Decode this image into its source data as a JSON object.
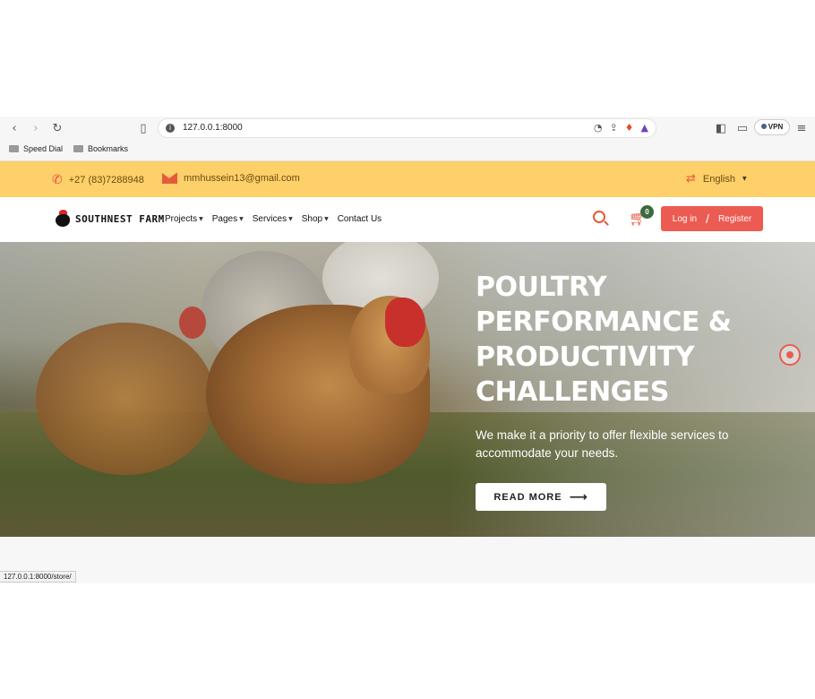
{
  "browser": {
    "url": "127.0.0.1:8000",
    "vpn_label": "VPN",
    "bookmarks": [
      "Speed Dial",
      "Bookmarks"
    ],
    "status_url": "127.0.0.1:8000/store/"
  },
  "topbar": {
    "phone": "+27 (83)7288948",
    "email": "mmhussein13@gmail.com",
    "language": "English"
  },
  "nav": {
    "logo_text": "SOUTHNEST FARM",
    "menu": [
      "Projects",
      "Pages",
      "Services",
      "Shop",
      "Contact Us"
    ],
    "cart_count": "0",
    "login": "Log in",
    "slash": "/",
    "register": "Register"
  },
  "hero": {
    "title": "POULTRY PERFORMANCE & PRODUCTIVITY CHALLENGES",
    "subtitle": "We make it a priority to offer flexible services to accommodate your needs.",
    "button": "READ MORE"
  },
  "colors": {
    "accent": "#ec5b52",
    "topbar": "#fdd069",
    "badge": "#3c6b3e"
  },
  "icons": [
    "back-icon",
    "forward-icon",
    "reload-icon",
    "bookmark-icon",
    "info-icon",
    "phone-icon",
    "mail-icon",
    "language-icon",
    "search-icon",
    "cart-icon",
    "arrow-right-icon"
  ]
}
